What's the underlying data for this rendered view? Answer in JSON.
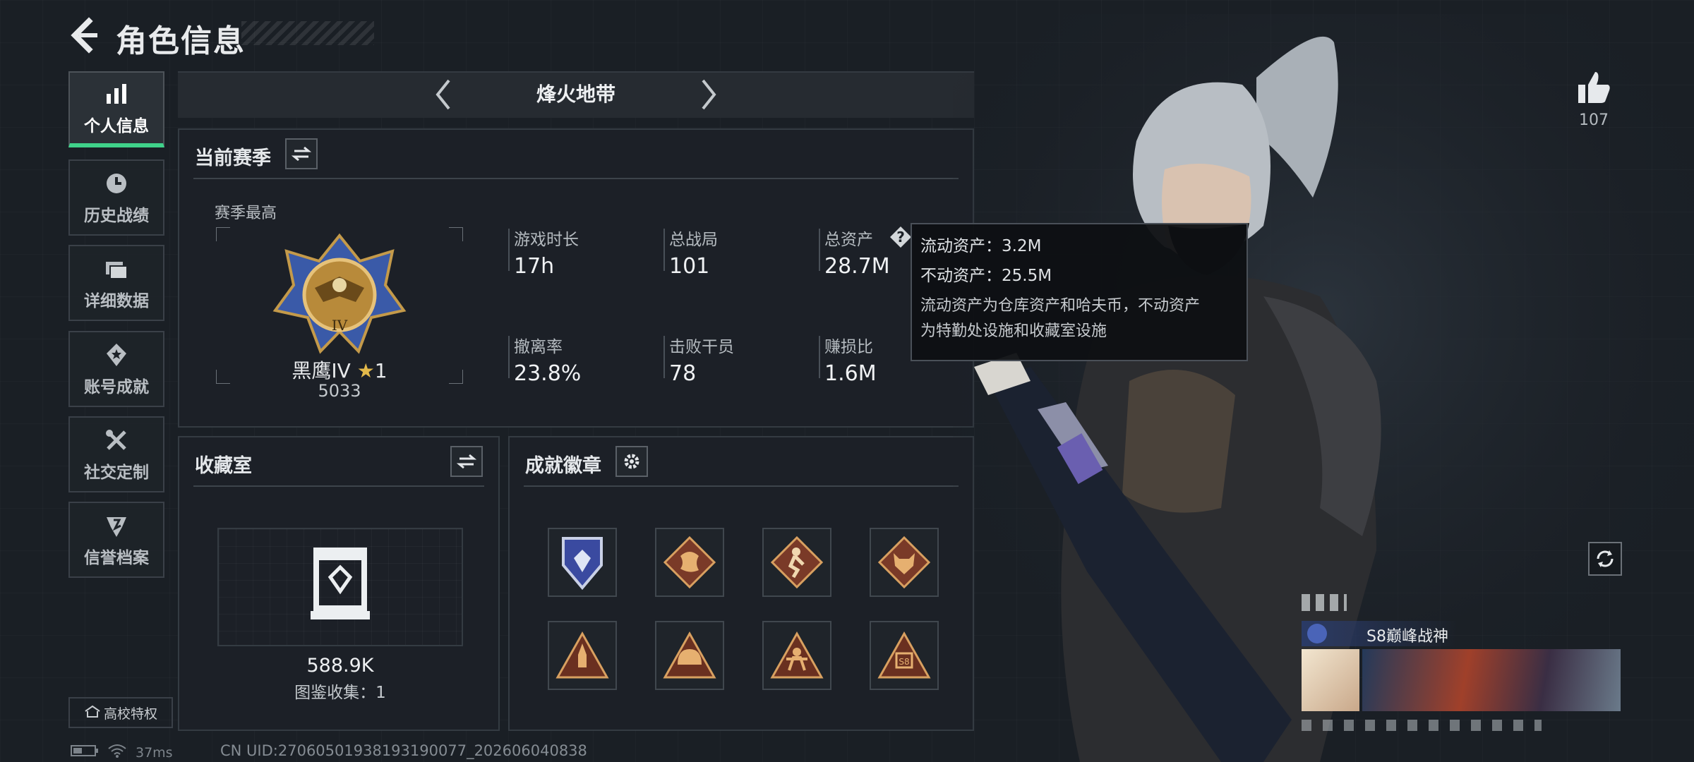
{
  "header": {
    "title": "角色信息"
  },
  "nav": {
    "items": [
      {
        "label": "个人信息",
        "icon": "bar-chart-icon",
        "active": true
      },
      {
        "label": "历史战绩",
        "icon": "clock-icon",
        "active": false
      },
      {
        "label": "详细数据",
        "icon": "folder-icon",
        "active": false
      },
      {
        "label": "账号成就",
        "icon": "medal-icon",
        "active": false
      },
      {
        "label": "社交定制",
        "icon": "tools-icon",
        "active": false
      },
      {
        "label": "信誉档案",
        "icon": "shield-icon",
        "active": false
      }
    ],
    "campus_label": "高校特权"
  },
  "mode": {
    "title": "烽火地带"
  },
  "season": {
    "title": "当前赛季",
    "best_label": "赛季最高",
    "rank_name": "黑鹰IV",
    "rank_stars": "1",
    "rank_score": "5033",
    "stats": [
      {
        "label": "游戏时长",
        "value": "17h"
      },
      {
        "label": "总战局",
        "value": "101"
      },
      {
        "label": "总资产",
        "value": "28.7M"
      },
      {
        "label": "撤离率",
        "value": "23.8%"
      },
      {
        "label": "击败干员",
        "value": "78"
      },
      {
        "label": "赚损比",
        "value": "1.6M"
      }
    ]
  },
  "tooltip": {
    "liquid": "流动资产：3.2M",
    "fixed": "不动资产：25.5M",
    "desc_line1": "流动资产为仓库资产和哈夫币，不动资产",
    "desc_line2": "为特勤处设施和收藏室设施"
  },
  "collection": {
    "title": "收藏室",
    "value": "588.9K",
    "catalog": "图鉴收集：1"
  },
  "achievements": {
    "title": "成就徽章",
    "badges": [
      "shield-badge-icon",
      "dragon-badge-icon",
      "runner-badge-icon",
      "wolf-badge-icon",
      "rocket-badge-icon",
      "helmet-badge-icon",
      "soldier-badge-icon",
      "s8-badge-icon"
    ]
  },
  "profile": {
    "likes": "107",
    "card_title": "S8巅峰战神"
  },
  "status": {
    "ping": "37ms",
    "uid": "CN UID:27060501938193190077_202606040838"
  },
  "colors": {
    "accent": "#3fd28a",
    "background": "#1a1f25",
    "panel": "#1c2127",
    "tooltip_bg": "#0e1013"
  }
}
